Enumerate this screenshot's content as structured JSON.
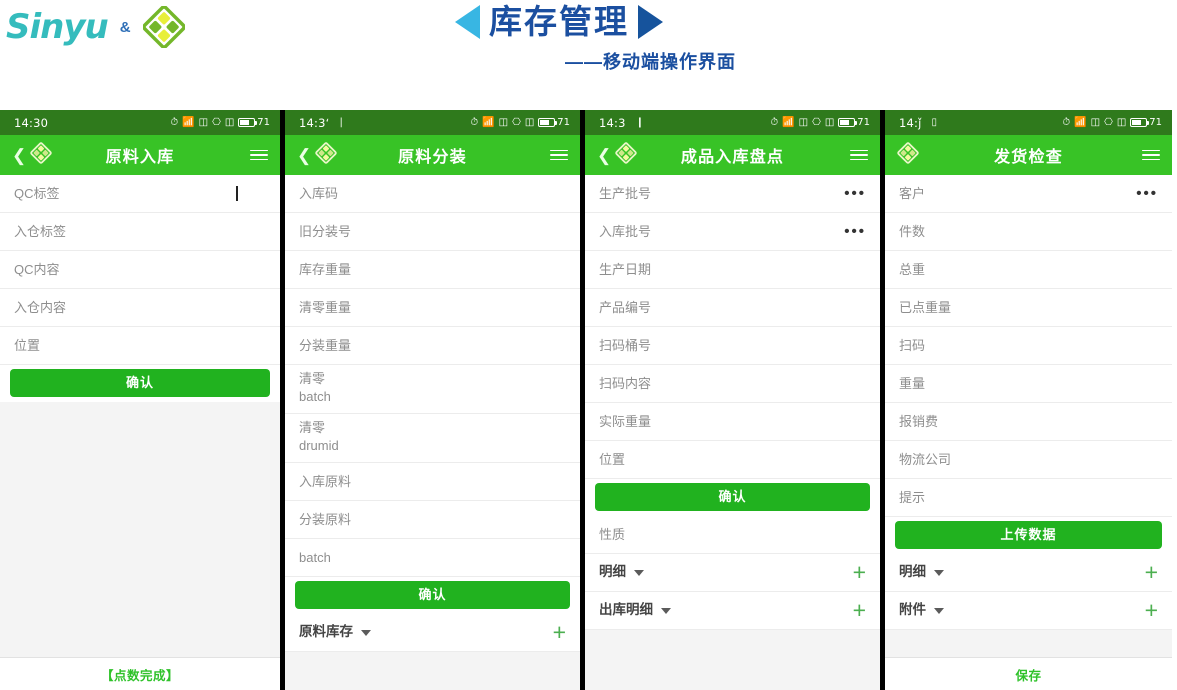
{
  "banner": {
    "brand_word": "Sinyu",
    "ampersand": "&",
    "logo_icon": "diamond-logo-icon",
    "title": "库存管理",
    "subtitle": "——移动端操作界面",
    "left_arrow_icon": "triangle-left-icon",
    "right_arrow_icon": "triangle-right-icon",
    "title_color": "#1b4fa0",
    "brand_color": "#35bcbd",
    "arrow_left_color": "#38b6e3",
    "arrow_right_color": "#16539c"
  },
  "theme": {
    "appbar_green": "#38c326",
    "statusbar_green": "#2f7a1c",
    "button_green": "#21b21f",
    "plus_green": "#4caf50",
    "label_grey": "#8e8e8e"
  },
  "screens": [
    {
      "status": {
        "time": "14:30",
        "notif": "",
        "battery": "71"
      },
      "appbar": {
        "back_icon": "chevron-left-icon",
        "logo_icon": "diamond-logo-icon",
        "title": "原料入库",
        "menu_icon": "hamburger-menu-icon"
      },
      "rows": [
        {
          "label": "QC标签",
          "right": "cursor"
        },
        {
          "label": "入仓标签",
          "right": ""
        },
        {
          "label": "QC内容",
          "right": ""
        },
        {
          "label": "入仓内容",
          "right": ""
        },
        {
          "label": "位置",
          "right": ""
        }
      ],
      "buttons": [
        {
          "label": "确认"
        }
      ],
      "extra_rows": [],
      "footer": "【点数完成】"
    },
    {
      "status": {
        "time": "14:3ʻ",
        "notif": "|",
        "battery": "71"
      },
      "appbar": {
        "back_icon": "chevron-left-icon",
        "logo_icon": "diamond-logo-icon",
        "title": "原料分装",
        "menu_icon": "hamburger-menu-icon"
      },
      "rows": [
        {
          "label": "入库码",
          "right": ""
        },
        {
          "label": "旧分装号",
          "right": ""
        },
        {
          "label": "库存重量",
          "right": ""
        },
        {
          "label": "清零重量",
          "right": ""
        },
        {
          "label": "分装重量",
          "right": ""
        },
        {
          "label": "清零\nbatch",
          "right": "",
          "tall": true
        },
        {
          "label": "清零\ndrumid",
          "right": "",
          "tall": true
        },
        {
          "label": "入库原料",
          "right": ""
        },
        {
          "label": "分装原料",
          "right": ""
        },
        {
          "label": "batch",
          "right": ""
        }
      ],
      "buttons": [
        {
          "label": "确认"
        }
      ],
      "extra_rows": [
        {
          "label": "原料库存",
          "caret": true,
          "right": "plus"
        }
      ],
      "footer": ""
    },
    {
      "status": {
        "time": "14:3",
        "notif": "❙",
        "battery": "71"
      },
      "appbar": {
        "back_icon": "chevron-left-icon",
        "logo_icon": "diamond-logo-icon",
        "title": "成品入库盘点",
        "menu_icon": "hamburger-menu-icon"
      },
      "rows": [
        {
          "label": "生产批号",
          "right": "dots"
        },
        {
          "label": "入库批号",
          "right": "dots"
        },
        {
          "label": "生产日期",
          "right": ""
        },
        {
          "label": "产品编号",
          "right": ""
        },
        {
          "label": "扫码桶号",
          "right": ""
        },
        {
          "label": "扫码内容",
          "right": ""
        },
        {
          "label": "实际重量",
          "right": ""
        },
        {
          "label": "位置",
          "right": ""
        }
      ],
      "buttons": [
        {
          "label": "确认"
        }
      ],
      "extra_rows": [
        {
          "label": "性质",
          "caret": false,
          "right": ""
        },
        {
          "label": "明细",
          "caret": true,
          "right": "plus"
        },
        {
          "label": "出库明细",
          "caret": true,
          "right": "plus"
        }
      ],
      "footer": ""
    },
    {
      "status": {
        "time": "14:ǰ",
        "notif": "▯",
        "battery": "71"
      },
      "appbar": {
        "back_icon": "",
        "logo_icon": "diamond-logo-icon",
        "title": "发货检查",
        "menu_icon": "hamburger-menu-icon"
      },
      "rows": [
        {
          "label": "客户",
          "right": "dots"
        },
        {
          "label": "件数",
          "right": ""
        },
        {
          "label": "总重",
          "right": ""
        },
        {
          "label": "已点重量",
          "right": ""
        },
        {
          "label": "扫码",
          "right": ""
        },
        {
          "label": "重量",
          "right": ""
        },
        {
          "label": "报销费",
          "right": ""
        },
        {
          "label": "物流公司",
          "right": ""
        },
        {
          "label": "提示",
          "right": ""
        }
      ],
      "buttons": [
        {
          "label": "上传数据"
        }
      ],
      "extra_rows": [
        {
          "label": "明细",
          "caret": true,
          "right": "plus"
        },
        {
          "label": "附件",
          "caret": true,
          "right": "plus"
        }
      ],
      "footer": "保存"
    }
  ]
}
